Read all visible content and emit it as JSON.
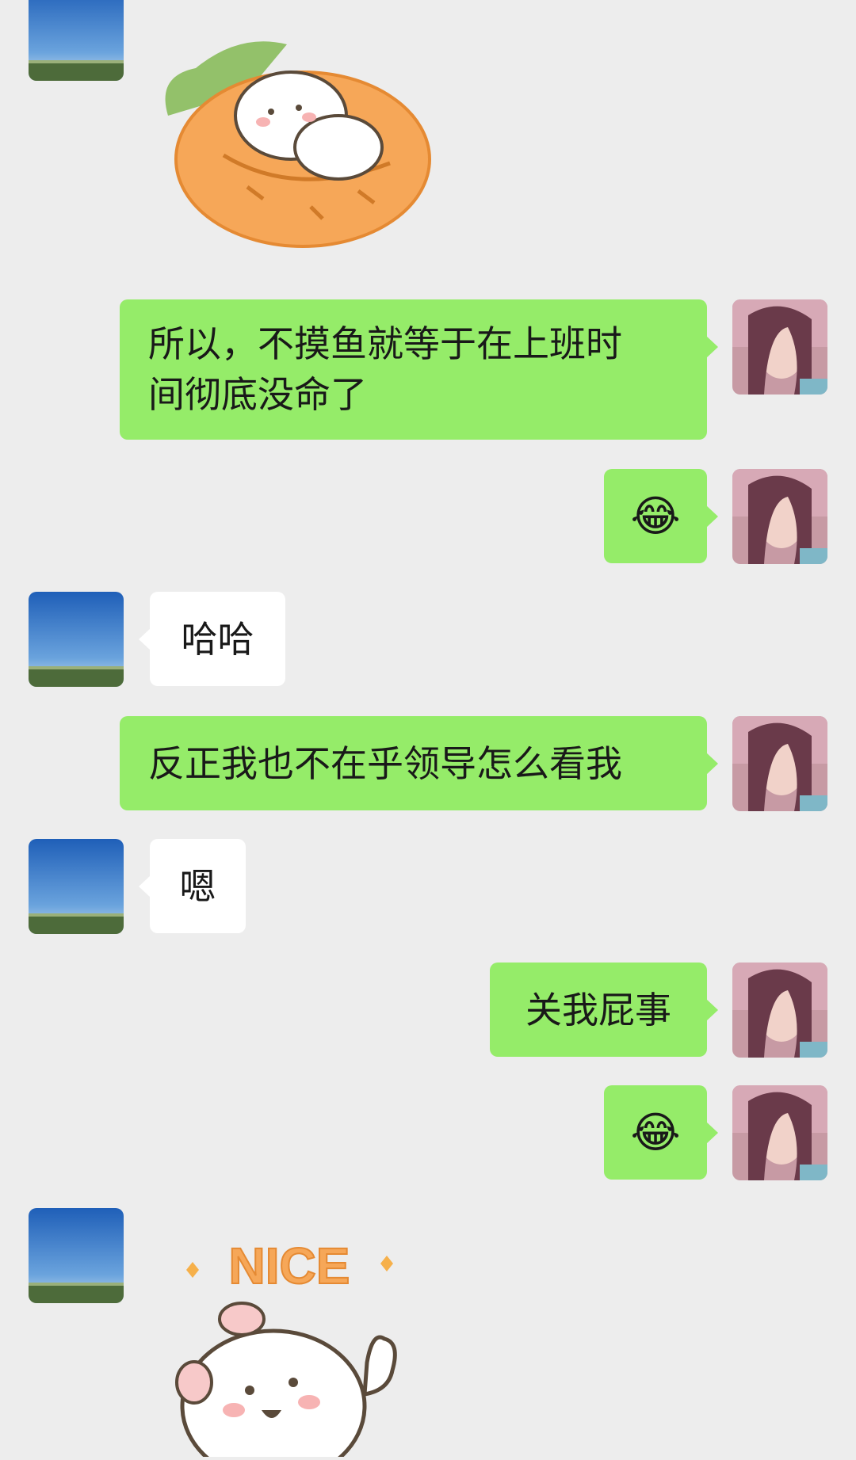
{
  "messages": [
    {
      "side": "left",
      "type": "sticker",
      "sticker": "hamster-on-cushion-sticker"
    },
    {
      "side": "right",
      "type": "text",
      "text_lines": [
        "所以，不摸鱼就等于在上班时",
        "间彻底没命了"
      ]
    },
    {
      "side": "right",
      "type": "emoji",
      "emoji": "😂"
    },
    {
      "side": "left",
      "type": "text",
      "text": "哈哈"
    },
    {
      "side": "right",
      "type": "text",
      "text": "反正我也不在乎领导怎么看我"
    },
    {
      "side": "left",
      "type": "text",
      "text": "嗯"
    },
    {
      "side": "right",
      "type": "text",
      "text": "关我屁事"
    },
    {
      "side": "right",
      "type": "emoji",
      "emoji": "😂"
    },
    {
      "side": "left",
      "type": "sticker",
      "sticker": "nice-thumbs-up-sticker",
      "sticker_text": "NICE"
    }
  ],
  "colors": {
    "background": "#ededed",
    "self_bubble": "#95ec69",
    "other_bubble": "#ffffff",
    "text": "#191919",
    "sticker_orange": "#f6a758"
  }
}
